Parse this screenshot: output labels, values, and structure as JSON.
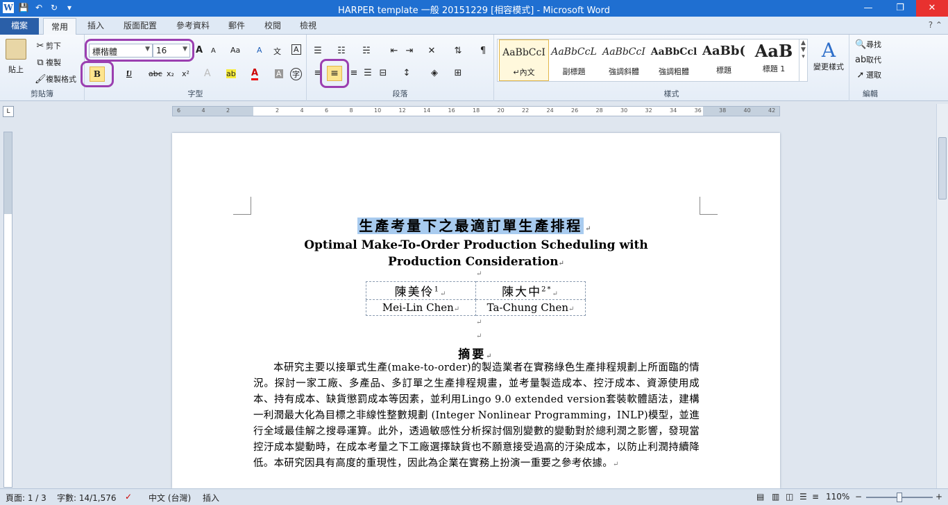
{
  "titlebar": {
    "title": "HARPER template 一般 20151229 [相容模式] - Microsoft Word",
    "app_letter": "W",
    "save": "💾",
    "undo": "↶",
    "redo": "↻",
    "customize": "▾",
    "min": "—",
    "max": "❐",
    "close": "✕"
  },
  "tabs": {
    "file": "檔案",
    "items": [
      "常用",
      "插入",
      "版面配置",
      "參考資料",
      "郵件",
      "校閱",
      "檢視"
    ],
    "active": "常用",
    "help": "? ⌃"
  },
  "clipboard": {
    "label": "剪貼簿",
    "paste": "貼上",
    "cut": "剪下",
    "copy": "複製",
    "format_painter": "複製格式"
  },
  "font": {
    "label": "字型",
    "name": "標楷體",
    "size": "16",
    "bold": "B",
    "italic": "I",
    "underline": "U",
    "strike": "abc",
    "sub": "x₂",
    "sup": "x²",
    "grow": "A",
    "shrink": "A",
    "case": "Aa",
    "clear": "A",
    "phonetic": "文",
    "border": "A",
    "effects": "A",
    "highlight": "ab",
    "color": "A",
    "shade": "A",
    "circle": "字"
  },
  "paragraph": {
    "label": "段落"
  },
  "styles": {
    "label": "樣式",
    "items": [
      {
        "sample": "AaBbCcI",
        "name": "↵內文"
      },
      {
        "sample": "AaBbCcL",
        "name": "副標題"
      },
      {
        "sample": "AaBbCcI",
        "name": "強調斜體"
      },
      {
        "sample": "AaBbCcl",
        "name": "強調粗體"
      },
      {
        "sample": "AaBb(",
        "name": "標題"
      },
      {
        "sample": "AaB",
        "name": "標題 1"
      }
    ],
    "change": "變更樣式"
  },
  "editing": {
    "label": "編輯",
    "find": "尋找",
    "replace": "取代",
    "select": "選取"
  },
  "ruler": {
    "ticks": [
      "6",
      "4",
      "2",
      "",
      "2",
      "4",
      "6",
      "8",
      "10",
      "12",
      "14",
      "16",
      "18",
      "20",
      "22",
      "24",
      "26",
      "28",
      "30",
      "32",
      "34",
      "36",
      "38",
      "40",
      "42"
    ]
  },
  "document": {
    "title_cn": "生產考量下之最適訂單生產排程",
    "title_en": "Optimal Make-To-Order Production Scheduling with Production Consideration",
    "authors_cn": [
      "陳美伶",
      "陳大中"
    ],
    "author_sup": [
      "1",
      "2*"
    ],
    "authors_en": [
      "Mei-Lin Chen",
      "Ta-Chung Chen"
    ],
    "abstract_heading": "摘要",
    "abstract": "本研究主要以接單式生產(make-to-order)的製造業者在實務綠色生產排程規劃上所面臨的情況。探討一家工廠、多產品、多訂單之生產排程規畫，並考量製造成本、控汙成本、資源使用成本、持有成本、缺貨懲罰成本等因素，並利用Lingo 9.0 extended version套裝軟體語法，建構一利潤最大化為目標之非線性整數規劃 (Integer Nonlinear Programming，INLP)模型，並進行全域最佳解之搜尋運算。此外，透過敏感性分析探討個別變數的變動對於總利潤之影響，發現當控汙成本變動時，在成本考量之下工廠選擇缺貨也不願意接受過高的汙染成本，以防止利潤持續降低。本研究因具有高度的重現性，因此為企業在實務上扮演一重要之參考依據。",
    "para_mark": "↵"
  },
  "status": {
    "page": "頁面: 1 / 3",
    "words": "字數: 14/1,576",
    "lang": "中文 (台灣)",
    "mode": "插入",
    "zoom": "110%",
    "minus": "−",
    "plus": "+"
  }
}
